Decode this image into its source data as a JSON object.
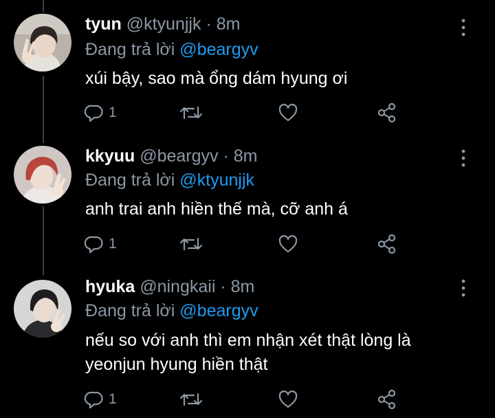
{
  "tweets": [
    {
      "name": "tyun",
      "handle": "@ktyunjjk",
      "separator": "·",
      "time": "8m",
      "replying_prefix": "Đang trả lời",
      "replying_to": "@beargyv",
      "text_lines": [
        "xúi bậy, sao mà ổng dám hyung ơi"
      ],
      "reply_count": "1",
      "avatar_colors": {
        "bg": "#b9b2ab",
        "hair": "#2e2622",
        "skin": "#e9d6c6",
        "shirt": "#e6e3df"
      },
      "icons": [
        "reply-icon",
        "retweet-icon",
        "like-icon",
        "share-icon",
        "more-icon"
      ]
    },
    {
      "name": "kkyuu",
      "handle": "@beargyv",
      "separator": "·",
      "time": "8m",
      "replying_prefix": "Đang trả lời",
      "replying_to": "@ktyunjjk",
      "text_lines": [
        "anh trai anh hiền thế mà, cỡ anh á"
      ],
      "reply_count": "1",
      "avatar_colors": {
        "bg": "#cfc7c4",
        "hair": "#b8463d",
        "skin": "#f0ddd2",
        "shirt": "#ece8e6"
      },
      "icons": [
        "reply-icon",
        "retweet-icon",
        "like-icon",
        "share-icon",
        "more-icon"
      ]
    },
    {
      "name": "hyuka",
      "handle": "@ningkaii",
      "separator": "·",
      "time": "8m",
      "replying_prefix": "Đang trả lời",
      "replying_to": "@beargyv",
      "text_lines": [
        "nếu so với anh thì em nhận xét thật lòng là",
        "yeonjun hyung hiền thật"
      ],
      "reply_count": "1",
      "avatar_colors": {
        "bg": "#d8d6d4",
        "hair": "#1f1d1f",
        "skin": "#eadbd0",
        "shirt": "#2a2a2e"
      },
      "icons": [
        "reply-icon",
        "retweet-icon",
        "like-icon",
        "share-icon",
        "more-icon"
      ]
    }
  ],
  "colors": {
    "background": "#000000",
    "text_primary": "#ffffff",
    "text_secondary": "#8b98a5",
    "mention": "#1d9bf0",
    "thread_line": "#3a3f44"
  }
}
